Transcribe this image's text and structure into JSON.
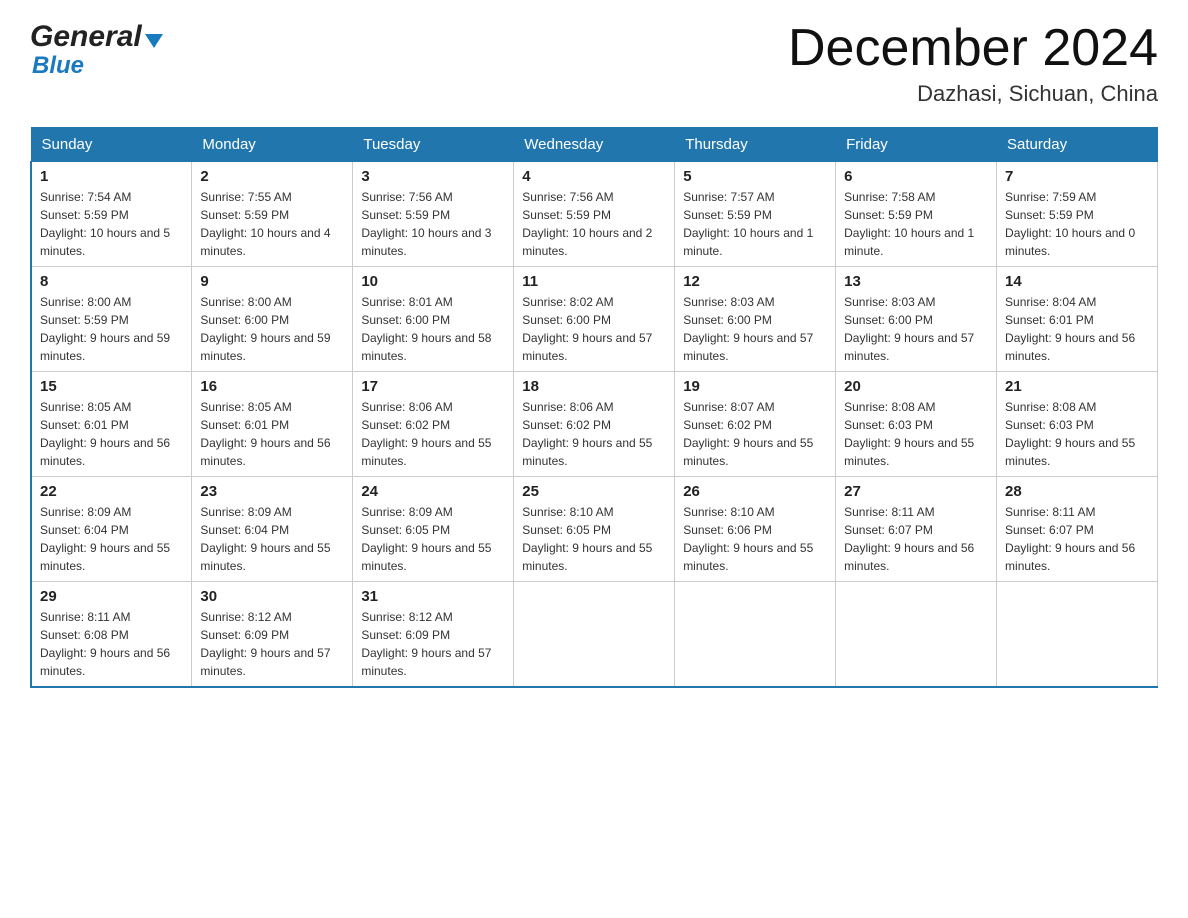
{
  "header": {
    "logo_top": "General",
    "logo_bottom": "Blue",
    "title": "December 2024",
    "location": "Dazhasi, Sichuan, China"
  },
  "days_of_week": [
    "Sunday",
    "Monday",
    "Tuesday",
    "Wednesday",
    "Thursday",
    "Friday",
    "Saturday"
  ],
  "weeks": [
    [
      {
        "day": "1",
        "sunrise": "7:54 AM",
        "sunset": "5:59 PM",
        "daylight": "10 hours and 5 minutes."
      },
      {
        "day": "2",
        "sunrise": "7:55 AM",
        "sunset": "5:59 PM",
        "daylight": "10 hours and 4 minutes."
      },
      {
        "day": "3",
        "sunrise": "7:56 AM",
        "sunset": "5:59 PM",
        "daylight": "10 hours and 3 minutes."
      },
      {
        "day": "4",
        "sunrise": "7:56 AM",
        "sunset": "5:59 PM",
        "daylight": "10 hours and 2 minutes."
      },
      {
        "day": "5",
        "sunrise": "7:57 AM",
        "sunset": "5:59 PM",
        "daylight": "10 hours and 1 minute."
      },
      {
        "day": "6",
        "sunrise": "7:58 AM",
        "sunset": "5:59 PM",
        "daylight": "10 hours and 1 minute."
      },
      {
        "day": "7",
        "sunrise": "7:59 AM",
        "sunset": "5:59 PM",
        "daylight": "10 hours and 0 minutes."
      }
    ],
    [
      {
        "day": "8",
        "sunrise": "8:00 AM",
        "sunset": "5:59 PM",
        "daylight": "9 hours and 59 minutes."
      },
      {
        "day": "9",
        "sunrise": "8:00 AM",
        "sunset": "6:00 PM",
        "daylight": "9 hours and 59 minutes."
      },
      {
        "day": "10",
        "sunrise": "8:01 AM",
        "sunset": "6:00 PM",
        "daylight": "9 hours and 58 minutes."
      },
      {
        "day": "11",
        "sunrise": "8:02 AM",
        "sunset": "6:00 PM",
        "daylight": "9 hours and 57 minutes."
      },
      {
        "day": "12",
        "sunrise": "8:03 AM",
        "sunset": "6:00 PM",
        "daylight": "9 hours and 57 minutes."
      },
      {
        "day": "13",
        "sunrise": "8:03 AM",
        "sunset": "6:00 PM",
        "daylight": "9 hours and 57 minutes."
      },
      {
        "day": "14",
        "sunrise": "8:04 AM",
        "sunset": "6:01 PM",
        "daylight": "9 hours and 56 minutes."
      }
    ],
    [
      {
        "day": "15",
        "sunrise": "8:05 AM",
        "sunset": "6:01 PM",
        "daylight": "9 hours and 56 minutes."
      },
      {
        "day": "16",
        "sunrise": "8:05 AM",
        "sunset": "6:01 PM",
        "daylight": "9 hours and 56 minutes."
      },
      {
        "day": "17",
        "sunrise": "8:06 AM",
        "sunset": "6:02 PM",
        "daylight": "9 hours and 55 minutes."
      },
      {
        "day": "18",
        "sunrise": "8:06 AM",
        "sunset": "6:02 PM",
        "daylight": "9 hours and 55 minutes."
      },
      {
        "day": "19",
        "sunrise": "8:07 AM",
        "sunset": "6:02 PM",
        "daylight": "9 hours and 55 minutes."
      },
      {
        "day": "20",
        "sunrise": "8:08 AM",
        "sunset": "6:03 PM",
        "daylight": "9 hours and 55 minutes."
      },
      {
        "day": "21",
        "sunrise": "8:08 AM",
        "sunset": "6:03 PM",
        "daylight": "9 hours and 55 minutes."
      }
    ],
    [
      {
        "day": "22",
        "sunrise": "8:09 AM",
        "sunset": "6:04 PM",
        "daylight": "9 hours and 55 minutes."
      },
      {
        "day": "23",
        "sunrise": "8:09 AM",
        "sunset": "6:04 PM",
        "daylight": "9 hours and 55 minutes."
      },
      {
        "day": "24",
        "sunrise": "8:09 AM",
        "sunset": "6:05 PM",
        "daylight": "9 hours and 55 minutes."
      },
      {
        "day": "25",
        "sunrise": "8:10 AM",
        "sunset": "6:05 PM",
        "daylight": "9 hours and 55 minutes."
      },
      {
        "day": "26",
        "sunrise": "8:10 AM",
        "sunset": "6:06 PM",
        "daylight": "9 hours and 55 minutes."
      },
      {
        "day": "27",
        "sunrise": "8:11 AM",
        "sunset": "6:07 PM",
        "daylight": "9 hours and 56 minutes."
      },
      {
        "day": "28",
        "sunrise": "8:11 AM",
        "sunset": "6:07 PM",
        "daylight": "9 hours and 56 minutes."
      }
    ],
    [
      {
        "day": "29",
        "sunrise": "8:11 AM",
        "sunset": "6:08 PM",
        "daylight": "9 hours and 56 minutes."
      },
      {
        "day": "30",
        "sunrise": "8:12 AM",
        "sunset": "6:09 PM",
        "daylight": "9 hours and 57 minutes."
      },
      {
        "day": "31",
        "sunrise": "8:12 AM",
        "sunset": "6:09 PM",
        "daylight": "9 hours and 57 minutes."
      },
      null,
      null,
      null,
      null
    ]
  ]
}
